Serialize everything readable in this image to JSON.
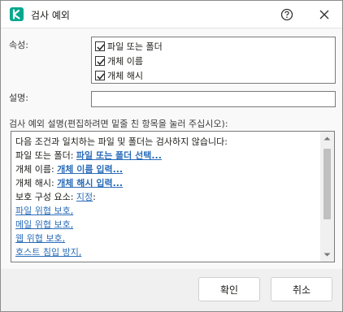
{
  "window": {
    "title": "검사 예외",
    "logo_icon": "kaspersky-k-icon",
    "accent_color": "#00a88e"
  },
  "form": {
    "attributes_label": "속성:",
    "attributes": [
      {
        "label": "파일 또는 폴더",
        "checked": true
      },
      {
        "label": "개체 이름",
        "checked": true
      },
      {
        "label": "개체 해시",
        "checked": true
      }
    ],
    "comment_label": "설명:",
    "comment_value": "",
    "rule_desc_label": "검사 예외 설명(편집하려면 밑줄 친 항목을 눌러 주십시오):"
  },
  "rule": {
    "intro": "다음 조건과 일치하는 파일 및 폴더는 검사하지 않습니다:",
    "file_prefix": "파일 또는 폴더: ",
    "file_link": "파일 또는 폴더 선택...",
    "name_prefix": "개체 이름: ",
    "name_link": "개체 이름 입력...",
    "hash_prefix": "개체 해시: ",
    "hash_link": "개체 해시 입력...",
    "components_prefix": "보호 구성 요소: ",
    "components_link": "지정",
    "components_suffix": ":",
    "components": [
      "파일 위협 보호,",
      "메일 위협 보호,",
      "웹 위협 보호,",
      "호스트 침입 방지,"
    ],
    "link_color": "#2a6cb8"
  },
  "buttons": {
    "ok": "확인",
    "cancel": "취소"
  }
}
